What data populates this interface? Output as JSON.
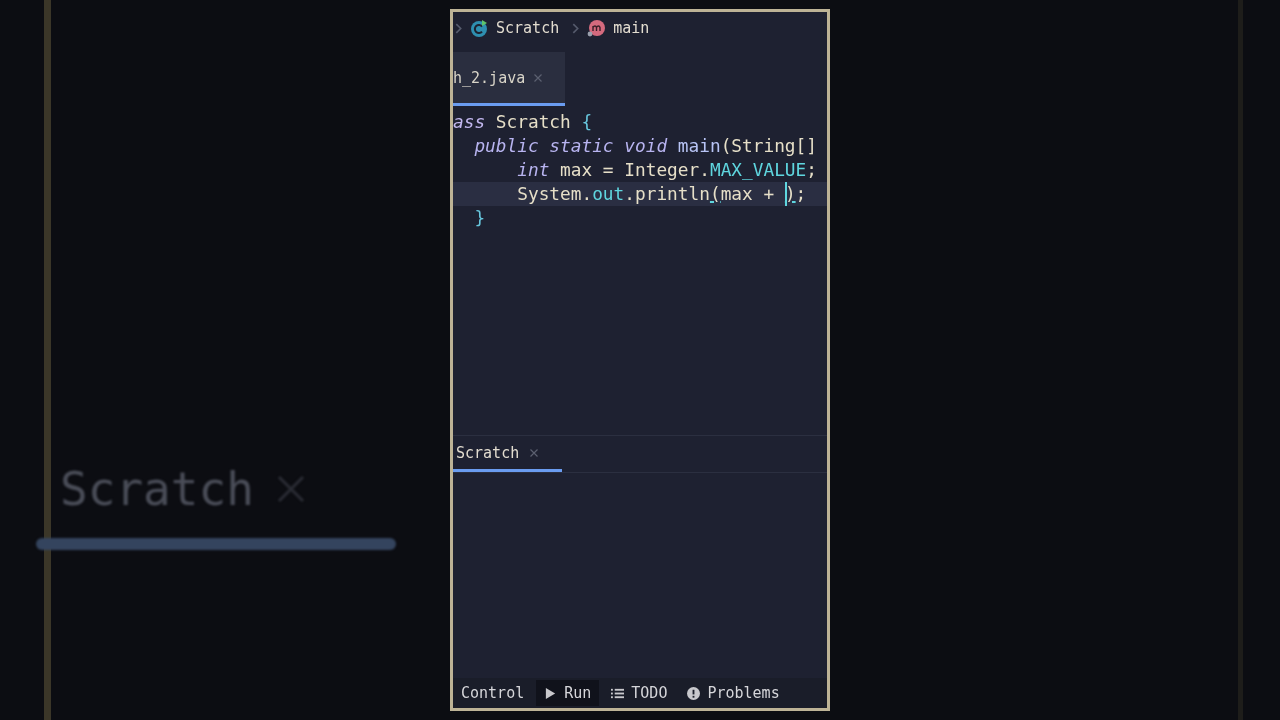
{
  "backdrop": {
    "label": "Scratch"
  },
  "breadcrumb": [
    {
      "label": "Scratch",
      "kind": "class"
    },
    {
      "label": "main",
      "kind": "method"
    }
  ],
  "editor_tabs": [
    {
      "label": "h_2.java",
      "selected": true
    }
  ],
  "code": [
    {
      "current": false,
      "tokens": [
        {
          "text": "ass ",
          "kind": "keyword-plain"
        },
        {
          "text": "Scratch ",
          "kind": "plain"
        },
        {
          "text": "{",
          "kind": "brace"
        }
      ],
      "children": [
        {
          "current": false,
          "tokens": [
            {
              "text": "public static void ",
              "kind": "keyword"
            },
            {
              "text": "main",
              "kind": "method"
            },
            {
              "text": "(String[]",
              "kind": "plain"
            }
          ],
          "children": [
            {
              "current": false,
              "tokens": [
                {
                  "text": "int ",
                  "kind": "keyword"
                },
                {
                  "text": "max = Integer.",
                  "kind": "plain"
                },
                {
                  "text": "MAX_VALUE",
                  "kind": "field"
                },
                {
                  "text": ";",
                  "kind": "plain"
                }
              ]
            },
            {
              "current": true,
              "tokens": [
                {
                  "text": "System.",
                  "kind": "plain"
                },
                {
                  "text": "out",
                  "kind": "field"
                },
                {
                  "text": ".println",
                  "kind": "plain"
                },
                {
                  "text": "(",
                  "kind": "match"
                },
                {
                  "text": "max + ",
                  "kind": "plain"
                },
                {
                  "text": ")",
                  "kind": "caret-match"
                },
                {
                  "text": ";",
                  "kind": "plain"
                }
              ]
            }
          ]
        },
        {
          "current": false,
          "tokens": [
            {
              "text": "}",
              "kind": "brace"
            }
          ]
        }
      ]
    }
  ],
  "run_panel": {
    "tabs": [
      {
        "label": "Scratch",
        "selected": true
      }
    ]
  },
  "tool_windows": [
    {
      "label": "Control",
      "kind": "plain",
      "selected": false
    },
    {
      "label": "Run",
      "kind": "run",
      "selected": true
    },
    {
      "label": "TODO",
      "kind": "todo",
      "selected": false
    },
    {
      "label": "Problems",
      "kind": "problems",
      "selected": false
    }
  ]
}
